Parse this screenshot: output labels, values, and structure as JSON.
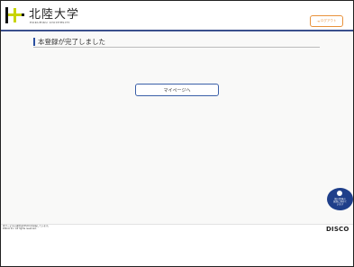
{
  "header": {
    "university_name": "北陸大学",
    "university_sub": "HOKURIKU UNIVERSITY",
    "logout_label": "ログアウト",
    "logout_icon": "logout-icon",
    "brand_color": "#3a4f8c",
    "accent_color": "#e8913a"
  },
  "main": {
    "page_title": "本登録が完了しました",
    "mypage_label": "マイページへ"
  },
  "badge": {
    "line1": "個人情報の",
    "line2": "保護に努めて",
    "line3": "います"
  },
  "footer": {
    "note_line1": "本サービスの運営はDISCOが担当しています。",
    "note_line2": "DISCO Inc. All rights reserved.",
    "company_logo": "DISCO"
  }
}
